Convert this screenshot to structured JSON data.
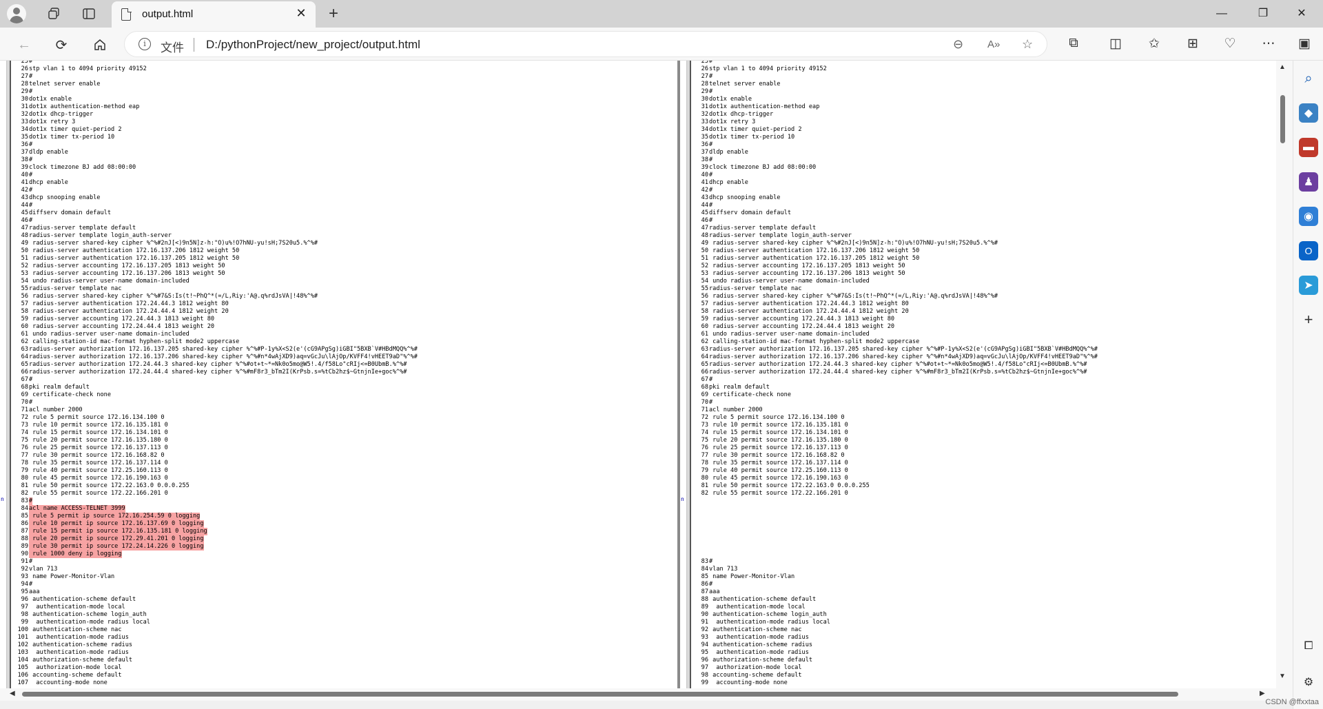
{
  "browser": {
    "tab_title": "output.html",
    "url_protocol": "文件",
    "url_path": "D:/pythonProject/new_project/output.html",
    "watermark": "CSDN @ffxxtaa"
  },
  "icons": {
    "back": "arrow-left-icon",
    "refresh": "refresh-icon",
    "home": "home-icon",
    "info": "info-icon",
    "zoom": "zoom-out-icon",
    "read_aloud": "read-aloud-icon",
    "favorite": "star-icon",
    "extensions": "puzzle-icon",
    "split": "split-screen-icon",
    "favorites_bar": "favorites-icon",
    "collections": "collections-icon",
    "performance": "heartbeat-icon",
    "more": "more-icon",
    "sidebar_toggle": "sidebar-icon"
  },
  "left": {
    "lines": [
      {
        "n": "25",
        "t": "#"
      },
      {
        "n": "26",
        "t": "stp vlan 1 to 4094 priority 49152"
      },
      {
        "n": "27",
        "t": "#"
      },
      {
        "n": "28",
        "t": "telnet server enable"
      },
      {
        "n": "29",
        "t": "#"
      },
      {
        "n": "30",
        "t": "dot1x enable"
      },
      {
        "n": "31",
        "t": "dot1x authentication-method eap"
      },
      {
        "n": "32",
        "t": "dot1x dhcp-trigger"
      },
      {
        "n": "33",
        "t": "dot1x retry 3"
      },
      {
        "n": "34",
        "t": "dot1x timer quiet-period 2"
      },
      {
        "n": "35",
        "t": "dot1x timer tx-period 10"
      },
      {
        "n": "36",
        "t": "#"
      },
      {
        "n": "37",
        "t": "dldp enable"
      },
      {
        "n": "38",
        "t": "#"
      },
      {
        "n": "39",
        "t": "clock timezone BJ add 08:00:00"
      },
      {
        "n": "40",
        "t": "#"
      },
      {
        "n": "41",
        "t": "dhcp enable"
      },
      {
        "n": "42",
        "t": "#"
      },
      {
        "n": "43",
        "t": "dhcp snooping enable"
      },
      {
        "n": "44",
        "t": "#"
      },
      {
        "n": "45",
        "t": "diffserv domain default"
      },
      {
        "n": "46",
        "t": "#"
      },
      {
        "n": "47",
        "t": "radius-server template default"
      },
      {
        "n": "48",
        "t": "radius-server template login_auth-server"
      },
      {
        "n": "49",
        "t": " radius-server shared-key cipher %^%#2nJ[<)9n5N]z-h:\"O)u%!O7hNU-yu!sH;7S20u5.%^%#"
      },
      {
        "n": "50",
        "t": " radius-server authentication 172.16.137.206 1812 weight 50"
      },
      {
        "n": "51",
        "t": " radius-server authentication 172.16.137.205 1812 weight 50"
      },
      {
        "n": "52",
        "t": " radius-server accounting 172.16.137.205 1813 weight 50"
      },
      {
        "n": "53",
        "t": " radius-server accounting 172.16.137.206 1813 weight 50"
      },
      {
        "n": "54",
        "t": " undo radius-server user-name domain-included"
      },
      {
        "n": "55",
        "t": "radius-server template nac"
      },
      {
        "n": "56",
        "t": " radius-server shared-key cipher %^%#7&S:Is(t!~PhQ^*(=/L,Riy:'A@.q%rdJsVA|!48%^%#"
      },
      {
        "n": "57",
        "t": " radius-server authentication 172.24.44.3 1812 weight 80"
      },
      {
        "n": "58",
        "t": " radius-server authentication 172.24.44.4 1812 weight 20"
      },
      {
        "n": "59",
        "t": " radius-server accounting 172.24.44.3 1813 weight 80"
      },
      {
        "n": "60",
        "t": " radius-server accounting 172.24.44.4 1813 weight 20"
      },
      {
        "n": "61",
        "t": " undo radius-server user-name domain-included"
      },
      {
        "n": "62",
        "t": " calling-station-id mac-format hyphen-split mode2 uppercase"
      },
      {
        "n": "63",
        "t": "radius-server authorization 172.16.137.205 shared-key cipher %^%#P-1y%X<S2(e'(cG9APgSg)iGBI\"5BXB`V#HBdMQQ%^%#"
      },
      {
        "n": "64",
        "t": "radius-server authorization 172.16.137.206 shared-key cipher %^%#n*4wAjXD9)aq=vGcJu\\lAjOp/KVFF4!vHEET9aD\"%^%#"
      },
      {
        "n": "65",
        "t": "radius-server authorization 172.24.44.3 shared-key cipher %^%#ot+t~*=Nk0o5mo@W5!.4/f58Lo\"cRIj<=B0UbmB.%^%#"
      },
      {
        "n": "66",
        "t": "radius-server authorization 172.24.44.4 shared-key cipher %^%#mF8r3_bTm2I(KrPsb.s=%tCb2hz$~GtnjnIe+goc%^%#"
      },
      {
        "n": "67",
        "t": "#"
      },
      {
        "n": "68",
        "t": "pki realm default"
      },
      {
        "n": "69",
        "t": " certificate-check none"
      },
      {
        "n": "70",
        "t": "#"
      },
      {
        "n": "71",
        "t": "acl number 2000"
      },
      {
        "n": "72",
        "t": " rule 5 permit source 172.16.134.100 0"
      },
      {
        "n": "73",
        "t": " rule 10 permit source 172.16.135.181 0"
      },
      {
        "n": "74",
        "t": " rule 15 permit source 172.16.134.101 0"
      },
      {
        "n": "75",
        "t": " rule 20 permit source 172.16.135.180 0"
      },
      {
        "n": "76",
        "t": " rule 25 permit source 172.16.137.113 0"
      },
      {
        "n": "77",
        "t": " rule 30 permit source 172.16.168.82 0"
      },
      {
        "n": "78",
        "t": " rule 35 permit source 172.16.137.114 0"
      },
      {
        "n": "79",
        "t": " rule 40 permit source 172.25.160.113 0"
      },
      {
        "n": "80",
        "t": " rule 45 permit source 172.16.190.163 0"
      },
      {
        "n": "81",
        "t": " rule 50 permit source 172.22.163.0 0.0.0.255"
      },
      {
        "n": "82",
        "t": " rule 55 permit source 172.22.166.201 0"
      },
      {
        "n": "83",
        "t": "#",
        "hl": true
      },
      {
        "n": "84",
        "t": "acl name ACCESS-TELNET 3999",
        "hl": true
      },
      {
        "n": "85",
        "t": " rule 5 permit ip source 172.16.254.59 0 logging",
        "hl": true
      },
      {
        "n": "86",
        "t": " rule 10 permit ip source 172.16.137.69 0 logging",
        "hl": true
      },
      {
        "n": "87",
        "t": " rule 15 permit ip source 172.16.135.181 0 logging",
        "hl": true
      },
      {
        "n": "88",
        "t": " rule 20 permit ip source 172.29.41.201 0 logging",
        "hl": true
      },
      {
        "n": "89",
        "t": " rule 30 permit ip source 172.24.14.226 0 logging",
        "hl": true
      },
      {
        "n": "90",
        "t": " rule 1000 deny ip logging",
        "hl": true
      },
      {
        "n": "91",
        "t": "#"
      },
      {
        "n": "92",
        "t": "vlan 713"
      },
      {
        "n": "93",
        "t": " name Power-Monitor-Vlan"
      },
      {
        "n": "94",
        "t": "#"
      },
      {
        "n": "95",
        "t": "aaa"
      },
      {
        "n": "96",
        "t": " authentication-scheme default"
      },
      {
        "n": "97",
        "t": "  authentication-mode local"
      },
      {
        "n": "98",
        "t": " authentication-scheme login_auth"
      },
      {
        "n": "99",
        "t": "  authentication-mode radius local"
      },
      {
        "n": "100",
        "t": " authentication-scheme nac"
      },
      {
        "n": "101",
        "t": "  authentication-mode radius"
      },
      {
        "n": "102",
        "t": " authentication-scheme radius"
      },
      {
        "n": "103",
        "t": "  authentication-mode radius"
      },
      {
        "n": "104",
        "t": " authorization-scheme default"
      },
      {
        "n": "105",
        "t": "  authorization-mode local"
      },
      {
        "n": "106",
        "t": " accounting-scheme default"
      },
      {
        "n": "107",
        "t": "  accounting-mode none"
      }
    ],
    "marker": "n"
  },
  "right": {
    "lines": [
      {
        "n": "25",
        "t": "#"
      },
      {
        "n": "26",
        "t": "stp vlan 1 to 4094 priority 49152"
      },
      {
        "n": "27",
        "t": "#"
      },
      {
        "n": "28",
        "t": "telnet server enable"
      },
      {
        "n": "29",
        "t": "#"
      },
      {
        "n": "30",
        "t": "dot1x enable"
      },
      {
        "n": "31",
        "t": "dot1x authentication-method eap"
      },
      {
        "n": "32",
        "t": "dot1x dhcp-trigger"
      },
      {
        "n": "33",
        "t": "dot1x retry 3"
      },
      {
        "n": "34",
        "t": "dot1x timer quiet-period 2"
      },
      {
        "n": "35",
        "t": "dot1x timer tx-period 10"
      },
      {
        "n": "36",
        "t": "#"
      },
      {
        "n": "37",
        "t": "dldp enable"
      },
      {
        "n": "38",
        "t": "#"
      },
      {
        "n": "39",
        "t": "clock timezone BJ add 08:00:00"
      },
      {
        "n": "40",
        "t": "#"
      },
      {
        "n": "41",
        "t": "dhcp enable"
      },
      {
        "n": "42",
        "t": "#"
      },
      {
        "n": "43",
        "t": "dhcp snooping enable"
      },
      {
        "n": "44",
        "t": "#"
      },
      {
        "n": "45",
        "t": "diffserv domain default"
      },
      {
        "n": "46",
        "t": "#"
      },
      {
        "n": "47",
        "t": "radius-server template default"
      },
      {
        "n": "48",
        "t": "radius-server template login_auth-server"
      },
      {
        "n": "49",
        "t": " radius-server shared-key cipher %^%#2nJ[<)9n5N]z-h:\"O)u%!O7hNU-yu!sH;7S20u5.%^%#"
      },
      {
        "n": "50",
        "t": " radius-server authentication 172.16.137.206 1812 weight 50"
      },
      {
        "n": "51",
        "t": " radius-server authentication 172.16.137.205 1812 weight 50"
      },
      {
        "n": "52",
        "t": " radius-server accounting 172.16.137.205 1813 weight 50"
      },
      {
        "n": "53",
        "t": " radius-server accounting 172.16.137.206 1813 weight 50"
      },
      {
        "n": "54",
        "t": " undo radius-server user-name domain-included"
      },
      {
        "n": "55",
        "t": "radius-server template nac"
      },
      {
        "n": "56",
        "t": " radius-server shared-key cipher %^%#7&S:Is(t!~PhQ^*(=/L,Riy:'A@.q%rdJsVA|!48%^%#"
      },
      {
        "n": "57",
        "t": " radius-server authentication 172.24.44.3 1812 weight 80"
      },
      {
        "n": "58",
        "t": " radius-server authentication 172.24.44.4 1812 weight 20"
      },
      {
        "n": "59",
        "t": " radius-server accounting 172.24.44.3 1813 weight 80"
      },
      {
        "n": "60",
        "t": " radius-server accounting 172.24.44.4 1813 weight 20"
      },
      {
        "n": "61",
        "t": " undo radius-server user-name domain-included"
      },
      {
        "n": "62",
        "t": " calling-station-id mac-format hyphen-split mode2 uppercase"
      },
      {
        "n": "63",
        "t": "radius-server authorization 172.16.137.205 shared-key cipher %^%#P-1y%X<S2(e'(cG9APgSg)iGBI\"5BXB`V#HBdMQQ%^%#"
      },
      {
        "n": "64",
        "t": "radius-server authorization 172.16.137.206 shared-key cipher %^%#n*4wAjXD9)aq=vGcJu\\lAjOp/KVFF4!vHEET9aD\"%^%#"
      },
      {
        "n": "65",
        "t": "radius-server authorization 172.24.44.3 shared-key cipher %^%#ot+t~*=Nk0o5mo@W5!.4/f58Lo\"cRIj<=B0UbmB.%^%#"
      },
      {
        "n": "66",
        "t": "radius-server authorization 172.24.44.4 shared-key cipher %^%#mF8r3_bTm2I(KrPsb.s=%tCb2hz$~GtnjnIe+goc%^%#"
      },
      {
        "n": "67",
        "t": "#"
      },
      {
        "n": "68",
        "t": "pki realm default"
      },
      {
        "n": "69",
        "t": " certificate-check none"
      },
      {
        "n": "70",
        "t": "#"
      },
      {
        "n": "71",
        "t": "acl number 2000"
      },
      {
        "n": "72",
        "t": " rule 5 permit source 172.16.134.100 0"
      },
      {
        "n": "73",
        "t": " rule 10 permit source 172.16.135.181 0"
      },
      {
        "n": "74",
        "t": " rule 15 permit source 172.16.134.101 0"
      },
      {
        "n": "75",
        "t": " rule 20 permit source 172.16.135.180 0"
      },
      {
        "n": "76",
        "t": " rule 25 permit source 172.16.137.113 0"
      },
      {
        "n": "77",
        "t": " rule 30 permit source 172.16.168.82 0"
      },
      {
        "n": "78",
        "t": " rule 35 permit source 172.16.137.114 0"
      },
      {
        "n": "79",
        "t": " rule 40 permit source 172.25.160.113 0"
      },
      {
        "n": "80",
        "t": " rule 45 permit source 172.16.190.163 0"
      },
      {
        "n": "81",
        "t": " rule 50 permit source 172.22.163.0 0.0.0.255"
      },
      {
        "n": "82",
        "t": " rule 55 permit source 172.22.166.201 0"
      },
      {
        "blank": true
      },
      {
        "blank": true
      },
      {
        "blank": true
      },
      {
        "blank": true
      },
      {
        "blank": true
      },
      {
        "blank": true
      },
      {
        "blank": true
      },
      {
        "blank": true
      },
      {
        "n": "83",
        "t": "#"
      },
      {
        "n": "84",
        "t": "vlan 713"
      },
      {
        "n": "85",
        "t": " name Power-Monitor-Vlan"
      },
      {
        "n": "86",
        "t": "#"
      },
      {
        "n": "87",
        "t": "aaa"
      },
      {
        "n": "88",
        "t": " authentication-scheme default"
      },
      {
        "n": "89",
        "t": "  authentication-mode local"
      },
      {
        "n": "90",
        "t": " authentication-scheme login_auth"
      },
      {
        "n": "91",
        "t": "  authentication-mode radius local"
      },
      {
        "n": "92",
        "t": " authentication-scheme nac"
      },
      {
        "n": "93",
        "t": "  authentication-mode radius"
      },
      {
        "n": "94",
        "t": " authentication-scheme radius"
      },
      {
        "n": "95",
        "t": "  authentication-mode radius"
      },
      {
        "n": "96",
        "t": " authorization-scheme default"
      },
      {
        "n": "97",
        "t": "  authorization-mode local"
      },
      {
        "n": "98",
        "t": " accounting-scheme default"
      },
      {
        "n": "99",
        "t": "  accounting-mode none"
      }
    ],
    "marker": "n"
  },
  "sidebar_icons": [
    "search-icon",
    "tag-icon",
    "toolbox-icon",
    "chess-icon",
    "copilot-icon",
    "outlook-icon",
    "send-icon",
    "add-icon"
  ],
  "colors": {
    "diff_highlight": "#f7a3a3",
    "titlebar": "#d3d3d3"
  }
}
